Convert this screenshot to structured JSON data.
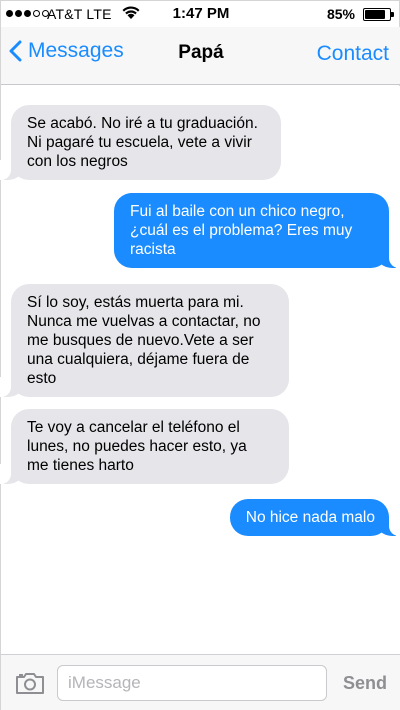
{
  "status_bar": {
    "carrier": "AT&T LTE",
    "time": "1:47 PM",
    "battery_percent": "85%",
    "battery_level": 0.85,
    "signal_bars_filled": 3,
    "signal_bars_total": 5
  },
  "nav": {
    "back_label": "Messages",
    "title": "Papá",
    "contact_label": "Contact"
  },
  "messages": [
    {
      "direction": "incoming",
      "text": "Se acabó. No iré a tu graduación.\nNi pagaré tu escuela, vete a vivir\ncon los negros"
    },
    {
      "direction": "outgoing",
      "text": "Fui al baile con un chico negro,\n¿cuál es el problema? Eres muy\nracista"
    },
    {
      "direction": "incoming",
      "text": "Sí lo soy, estás muerta para mi.\nNunca me vuelvas a contactar, no\nme busques de nuevo.Vete a ser\nuna cualquiera, déjame fuera de\nesto"
    },
    {
      "direction": "incoming",
      "text": "Te voy a cancelar el teléfono el\nlunes, no puedes hacer esto, ya\nme tienes harto"
    },
    {
      "direction": "outgoing",
      "text": "No hice nada malo"
    }
  ],
  "composer": {
    "placeholder": "iMessage",
    "value": "",
    "send_label": "Send"
  },
  "colors": {
    "accent": "#1a8cff",
    "incoming_bubble": "#e5e5ea",
    "outgoing_bubble": "#1a8cff"
  }
}
